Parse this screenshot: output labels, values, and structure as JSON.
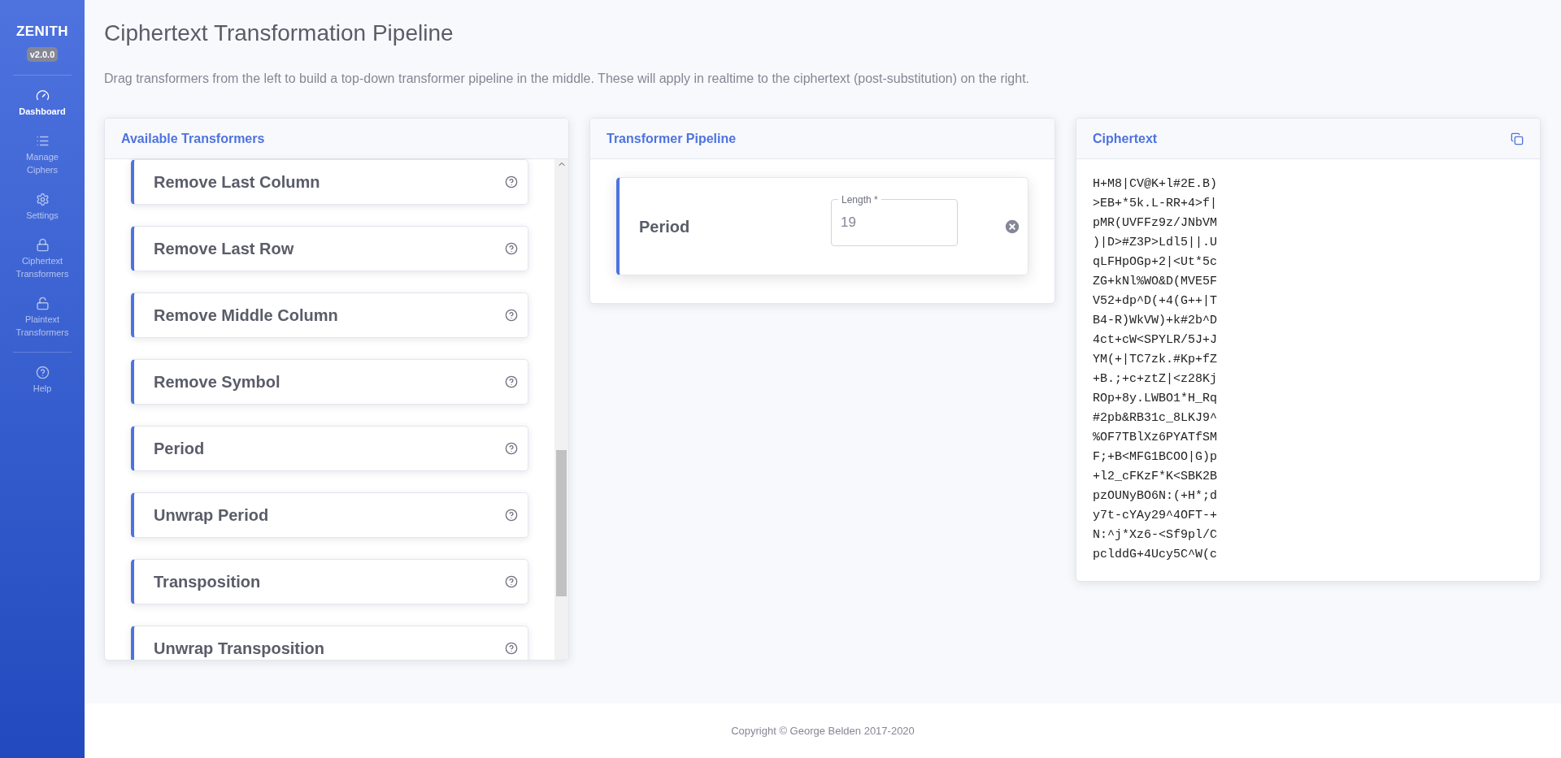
{
  "sidebar": {
    "brand": "ZENITH",
    "version": "v2.0.0",
    "items": [
      {
        "label": "Dashboard",
        "selected": true
      },
      {
        "label": "Manage Ciphers",
        "selected": false
      },
      {
        "label": "Settings",
        "selected": false
      },
      {
        "label": "Ciphertext Transformers",
        "selected": false
      },
      {
        "label": "Plaintext Transformers",
        "selected": false
      },
      {
        "label": "Help",
        "selected": false
      }
    ]
  },
  "page": {
    "title": "Ciphertext Transformation Pipeline",
    "description": "Drag transformers from the left to build a top-down transformer pipeline in the middle. These will apply in realtime to the ciphertext (post-substitution) on the right."
  },
  "available": {
    "title": "Available Transformers",
    "items": [
      "Remove Last Column",
      "Remove Last Row",
      "Remove Middle Column",
      "Remove Symbol",
      "Period",
      "Unwrap Period",
      "Transposition",
      "Unwrap Transposition"
    ]
  },
  "pipeline": {
    "title": "Transformer Pipeline",
    "items": [
      {
        "name": "Period",
        "field_label": "Length *",
        "value": "19"
      }
    ]
  },
  "ciphertext": {
    "title": "Ciphertext",
    "lines": [
      "H+M8|CV@K+l#2E.B)",
      ">EB+*5k.L-RR+4>f|",
      "pMR(UVFFz9z/JNbVM",
      ")|D>#Z3P>Ldl5||.U",
      "qLFHpOGp+2|<Ut*5c",
      "ZG+kNl%WO&D(MVE5F",
      "V52+dp^D(+4(G++|T",
      "B4-R)WkVW)+k#2b^D",
      "4ct+cW<SPYLR/5J+J",
      "YM(+|TC7zk.#Kp+fZ",
      "+B.;+c+ztZ|<z28Kj",
      "ROp+8y.LWBO1*H_Rq",
      "#2pb&RB31c_8LKJ9^",
      "%OF7TBlXz6PYATfSM",
      "F;+B<MFG1BCOO|G)p",
      "+l2_cFKzF*K<SBK2B",
      "pzOUNyBO6N:(+H*;d",
      "y7t-cYAy29^4OFT-+",
      "N:^j*Xz6-<Sf9pl/C",
      "pclddG+4Ucy5C^W(c"
    ]
  },
  "footer": "Copyright © George Belden 2017-2020"
}
